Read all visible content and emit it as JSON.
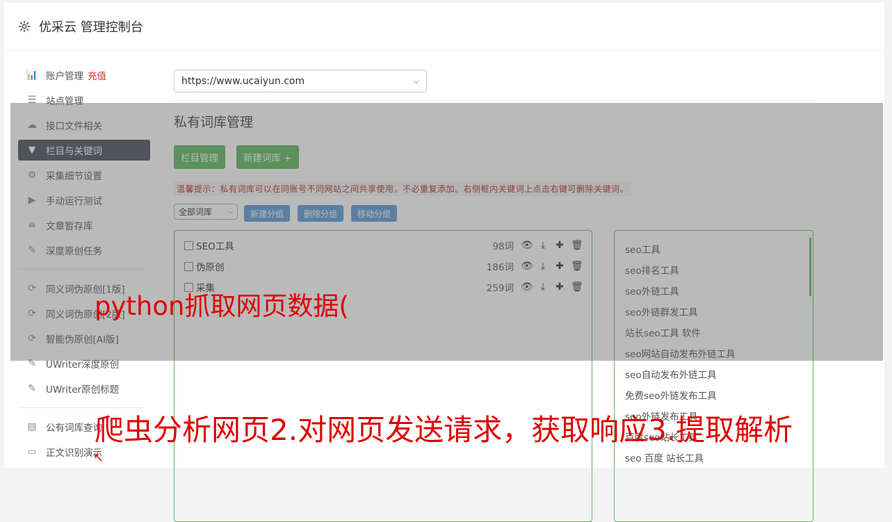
{
  "header": {
    "title": "优采云 管理控制台",
    "icon": "gear-icon"
  },
  "sidebar": {
    "items": [
      {
        "label": "账户管理",
        "badge": "充值",
        "icon": "bar-chart-icon",
        "glyph": "📊"
      },
      {
        "label": "站点管理",
        "icon": "server-icon",
        "glyph": "☰"
      },
      {
        "label": "接口文件相关",
        "icon": "cloud-upload-icon",
        "glyph": "☁"
      },
      {
        "label": "栏目与关键词",
        "icon": "filter-icon",
        "glyph": "▼",
        "active": true
      },
      {
        "label": "采集细节设置",
        "icon": "cogs-icon",
        "glyph": "⚙"
      },
      {
        "label": "手动运行测试",
        "icon": "play-circle-icon",
        "glyph": "▶"
      },
      {
        "label": "文章暂存库",
        "icon": "database-icon",
        "glyph": "≡"
      },
      {
        "label": "深度原创任务",
        "icon": "edit-icon",
        "glyph": "✎"
      },
      {
        "label": "同义词伪原创[1版]",
        "icon": "refresh-icon",
        "glyph": "⟳"
      },
      {
        "label": "同义词伪原创[2版]",
        "icon": "refresh-icon",
        "glyph": "⟳"
      },
      {
        "label": "智能伪原创[AI版]",
        "icon": "refresh-icon",
        "glyph": "⟳"
      },
      {
        "label": "UWriter深度原创",
        "icon": "edit-icon",
        "glyph": "✎"
      },
      {
        "label": "UWriter原创标题",
        "icon": "edit-icon",
        "glyph": "✎"
      },
      {
        "label": "公有词库查询",
        "icon": "book-icon",
        "glyph": "▤"
      },
      {
        "label": "正文识别演示",
        "icon": "desktop-icon",
        "glyph": "▭"
      }
    ]
  },
  "main": {
    "site_select": "https://www.ucaiyun.com",
    "section_title": "私有词库管理",
    "buttons": {
      "column_manage": "栏目管理",
      "new_lexicon": "新建词库 +"
    },
    "tip": "温馨提示：私有词库可以在同账号不同网站之间共享使用，不必重复添加。右侧框内关键词上点击右键可删除关键词。",
    "group_select": "全部词库",
    "group_buttons": {
      "new_group": "新建分组",
      "delete_group": "删除分组",
      "move_group": "移动分组"
    },
    "lexicons": [
      {
        "name": "SEO工具",
        "count": "98词"
      },
      {
        "name": "伪原创",
        "count": "186词"
      },
      {
        "name": "采集",
        "count": "259词"
      }
    ],
    "keywords": [
      "seo工具",
      "seo排名工具",
      "seo外链工具",
      "seo外链群发工具",
      "站长seo工具 软件",
      "seo网站自动发布外链工具",
      "seo自动发布外链工具",
      "免费seo外链发布工具",
      "seo外链发布工具",
      "百度seo站长工具",
      "seo 百度 站长工具"
    ]
  },
  "overlay": {
    "caption1": "python抓取网页数据(",
    "caption2": "爬虫分析网页2.对网页发送请求，获取响应3.提取解析"
  },
  "colors": {
    "accent_green": "#5cb85c",
    "accent_blue": "#5b9bd5",
    "caption_red": "#e00000",
    "active_nav": "#4a4f5a"
  }
}
